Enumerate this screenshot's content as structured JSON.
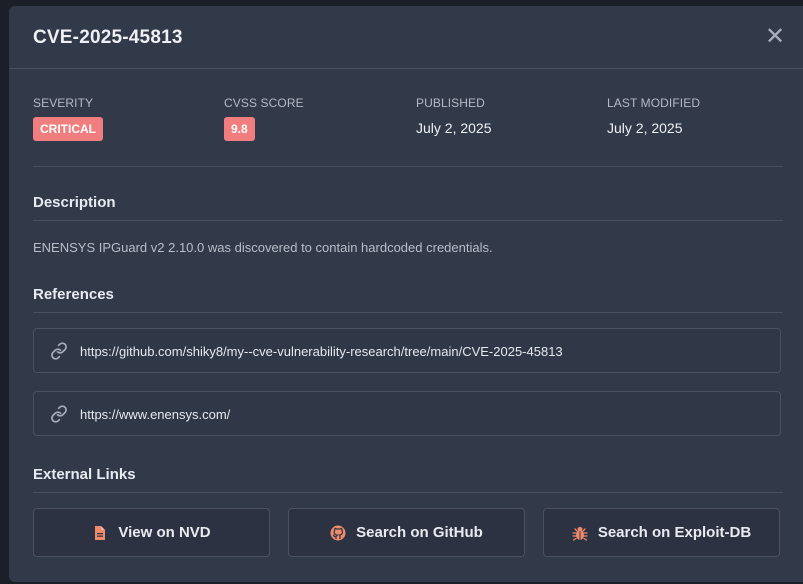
{
  "modal": {
    "title": "CVE-2025-45813",
    "close_glyph": "✕"
  },
  "meta": {
    "severity_label": "SEVERITY",
    "severity_value": "CRITICAL",
    "cvss_label": "CVSS SCORE",
    "cvss_value": "9.8",
    "published_label": "PUBLISHED",
    "published_value": "July 2, 2025",
    "modified_label": "LAST MODIFIED",
    "modified_value": "July 2, 2025"
  },
  "description": {
    "heading": "Description",
    "text": "ENENSYS IPGuard v2 2.10.0 was discovered to contain hardcoded credentials."
  },
  "references": {
    "heading": "References",
    "items": [
      {
        "url": "https://github.com/shiky8/my--cve-vulnerability-research/tree/main/CVE-2025-45813",
        "icon": "link-icon"
      },
      {
        "url": "https://www.enensys.com/",
        "icon": "link-icon"
      }
    ]
  },
  "external_links": {
    "heading": "External Links",
    "buttons": [
      {
        "label": "View on NVD",
        "icon": "document-icon"
      },
      {
        "label": "Search on GitHub",
        "icon": "github-icon"
      },
      {
        "label": "Search on Exploit-DB",
        "icon": "bug-icon"
      }
    ]
  },
  "colors": {
    "modal_bg": "#323949",
    "badge_bg": "#f07e7e",
    "icon_accent": "#f08a6a"
  }
}
